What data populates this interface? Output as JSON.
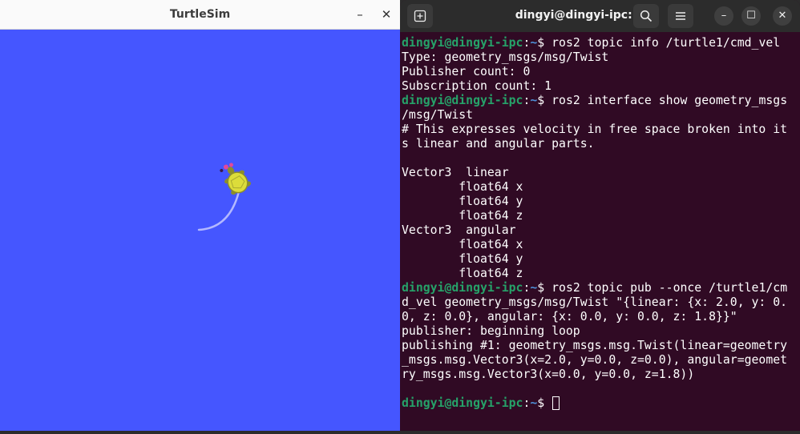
{
  "turtlesim": {
    "title": "TurtleSim",
    "minimize_glyph": "–",
    "close_glyph": "✕",
    "background_color": "#4556ff",
    "trail_color": "#b3b8ff",
    "turtle_icon": "turtle-icon"
  },
  "terminal": {
    "title": "dingyi@dingyi-ipc: ~",
    "new_tab_icon": "new-tab-icon",
    "search_icon": "search-icon",
    "menu_icon": "hamburger-menu-icon",
    "minimize_glyph": "–",
    "maximize_glyph": "☐",
    "close_glyph": "✕",
    "colors": {
      "background": "#300a24",
      "prompt_user": "#26a269",
      "prompt_path": "#4e8fd6",
      "text": "#ffffff"
    },
    "prompt_user": "dingyi@dingyi-ipc",
    "prompt_sep": ":",
    "prompt_path": "~",
    "prompt_end": "$ ",
    "lines": [
      {
        "prompt": true,
        "text": "ros2 topic info /turtle1/cmd_vel"
      },
      {
        "prompt": false,
        "text": "Type: geometry_msgs/msg/Twist"
      },
      {
        "prompt": false,
        "text": "Publisher count: 0"
      },
      {
        "prompt": false,
        "text": "Subscription count: 1"
      },
      {
        "prompt": true,
        "text": "ros2 interface show geometry_msgs"
      },
      {
        "prompt": false,
        "text": "/msg/Twist"
      },
      {
        "prompt": false,
        "text": "# This expresses velocity in free space broken into it"
      },
      {
        "prompt": false,
        "text": "s linear and angular parts."
      },
      {
        "prompt": false,
        "text": ""
      },
      {
        "prompt": false,
        "text": "Vector3  linear"
      },
      {
        "prompt": false,
        "text": "        float64 x"
      },
      {
        "prompt": false,
        "text": "        float64 y"
      },
      {
        "prompt": false,
        "text": "        float64 z"
      },
      {
        "prompt": false,
        "text": "Vector3  angular"
      },
      {
        "prompt": false,
        "text": "        float64 x"
      },
      {
        "prompt": false,
        "text": "        float64 y"
      },
      {
        "prompt": false,
        "text": "        float64 z"
      },
      {
        "prompt": true,
        "text": "ros2 topic pub --once /turtle1/cm"
      },
      {
        "prompt": false,
        "text": "d_vel geometry_msgs/msg/Twist \"{linear: {x: 2.0, y: 0."
      },
      {
        "prompt": false,
        "text": "0, z: 0.0}, angular: {x: 0.0, y: 0.0, z: 1.8}}\""
      },
      {
        "prompt": false,
        "text": "publisher: beginning loop"
      },
      {
        "prompt": false,
        "text": "publishing #1: geometry_msgs.msg.Twist(linear=geometry"
      },
      {
        "prompt": false,
        "text": "_msgs.msg.Vector3(x=2.0, y=0.0, z=0.0), angular=geomet"
      },
      {
        "prompt": false,
        "text": "ry_msgs.msg.Vector3(x=0.0, y=0.0, z=1.8))"
      },
      {
        "prompt": false,
        "text": ""
      },
      {
        "prompt": true,
        "text": "",
        "cursor": true
      }
    ]
  }
}
